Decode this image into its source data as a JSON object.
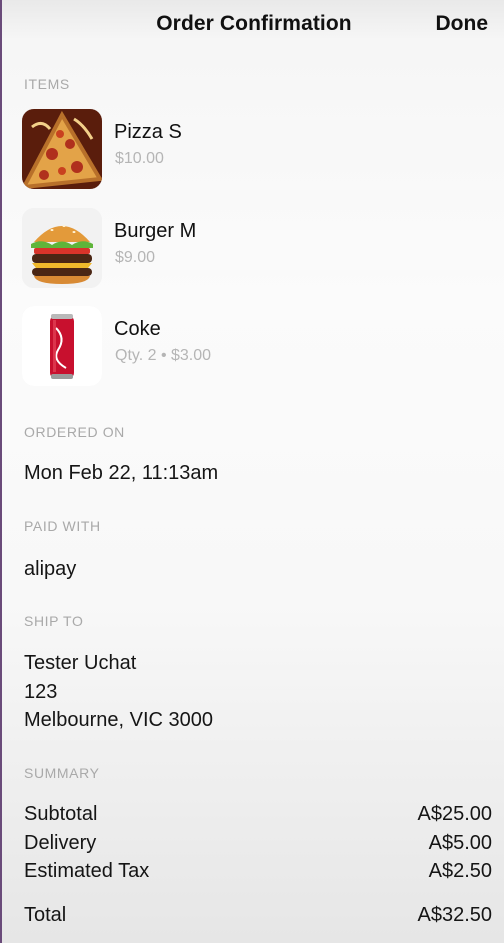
{
  "navbar": {
    "title": "Order Confirmation",
    "done_label": "Done"
  },
  "sections": {
    "items_label": "ITEMS",
    "ordered_on_label": "ORDERED ON",
    "paid_with_label": "PAID WITH",
    "ship_to_label": "SHIP TO",
    "summary_label": "SUMMARY"
  },
  "items": [
    {
      "name": "Pizza S",
      "detail": "$10.00",
      "icon": "pizza-image"
    },
    {
      "name": "Burger M",
      "detail": "$9.00",
      "icon": "burger-image"
    },
    {
      "name": "Coke",
      "detail": "Qty. 2 • $3.00",
      "icon": "coke-can-image"
    }
  ],
  "ordered_on": "Mon Feb 22, 11:13am",
  "paid_with": "alipay",
  "ship_to": {
    "name": "Tester Uchat",
    "line1": "123",
    "line2": "Melbourne, VIC 3000"
  },
  "summary": {
    "subtotal_label": "Subtotal",
    "subtotal": "A$25.00",
    "delivery_label": "Delivery",
    "delivery": "A$5.00",
    "tax_label": "Estimated Tax",
    "tax": "A$2.50",
    "total_label": "Total",
    "total": "A$32.50"
  },
  "colors": {
    "text": "#151515",
    "muted": "#a9a9a9",
    "coke_red": "#c8102e"
  }
}
